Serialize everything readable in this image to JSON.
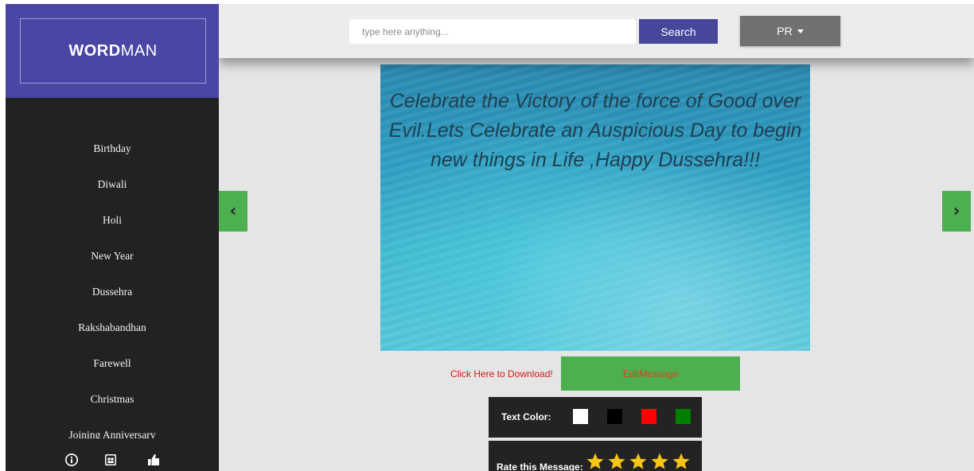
{
  "logo": {
    "bold": "WORD",
    "light": "MAN"
  },
  "sidebar": {
    "items": [
      {
        "label": "Birthday"
      },
      {
        "label": "Diwali"
      },
      {
        "label": "Holi"
      },
      {
        "label": "New Year"
      },
      {
        "label": "Dussehra"
      },
      {
        "label": "Rakshabandhan"
      },
      {
        "label": "Farewell"
      },
      {
        "label": "Christmas"
      },
      {
        "label": "Joining Anniversary"
      }
    ],
    "footer_icons": [
      "info-icon",
      "contact-icon",
      "thumbs-up-icon"
    ]
  },
  "topbar": {
    "search_placeholder": "type here anything...",
    "search_label": "Search",
    "language_label": "PR"
  },
  "card": {
    "message": "Celebrate the Victory of the force of Good over Evil.Lets Celebrate an Auspicious Day to begin new things in Life ,Happy Dussehra!!!"
  },
  "nav": {
    "prev": "‹",
    "next": "›"
  },
  "actions": {
    "download": "Click Here to Download!",
    "edit": "EditMessage"
  },
  "text_color": {
    "label": "Text Color:",
    "colors": [
      "#ffffff",
      "#000000",
      "#ff0000",
      "#008000"
    ]
  },
  "rating": {
    "label": "Rate this Message:",
    "stars": 5
  },
  "colors": {
    "brand": "#4a46a3",
    "sidebar": "#222222",
    "accent_green": "#4caf50",
    "search_button": "#46469b"
  }
}
